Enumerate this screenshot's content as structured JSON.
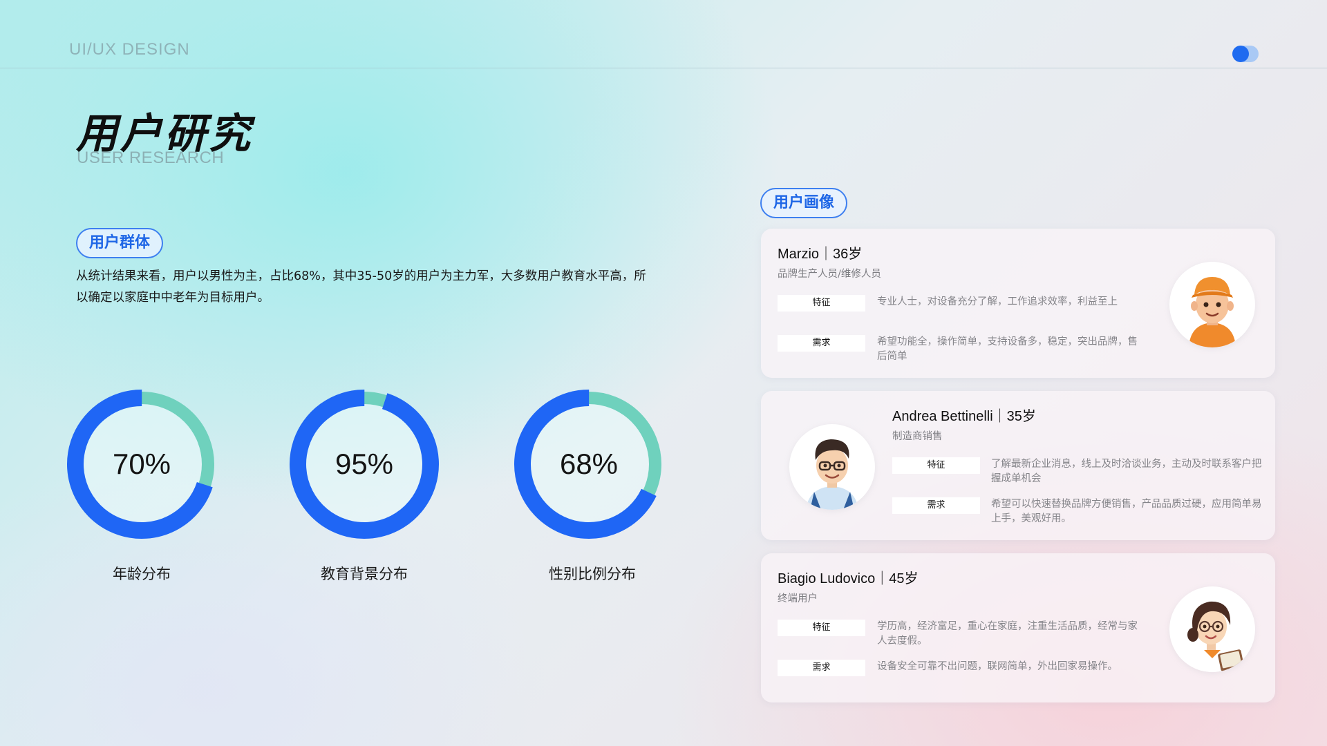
{
  "header": {
    "brand": "UI/UX DESIGN"
  },
  "page": {
    "title": "用户研究",
    "subtitle": "USER RESEARCH"
  },
  "user_group": {
    "label": "用户群体",
    "description": "从统计结果来看，用户以男性为主，占比68%，其中35-50岁的用户为主力军，大多数用户教育水平高，所以确定以家庭中中老年为目标用户。"
  },
  "stats": [
    {
      "value": "70%",
      "fraction": 0.7,
      "caption": "年龄分布"
    },
    {
      "value": "95%",
      "fraction": 0.95,
      "caption": "教育背景分布"
    },
    {
      "value": "68%",
      "fraction": 0.68,
      "caption": "性别比例分布"
    }
  ],
  "colors": {
    "accent": "#1f6bf0",
    "ring_primary": "#1f66f5",
    "ring_secondary": "#6fd1bd",
    "pill_text": "#1e66e6"
  },
  "personas_label": "用户画像",
  "personas": [
    {
      "name": "Marzio｜36岁",
      "role": "品牌生产人员/维修人员",
      "traits_tag": "特征",
      "traits": "专业人士，对设备充分了解，工作追求效率，利益至上",
      "needs_tag": "需求",
      "needs": "希望功能全，操作简单，支持设备多，稳定，突出品牌，售后简单",
      "avatar_icon": "worker-avatar-icon"
    },
    {
      "name": "Andrea  Bettinelli｜35岁",
      "role": "制造商销售",
      "traits_tag": "特征",
      "traits": "了解最新企业消息，线上及时洽谈业务，主动及时联系客户把握成单机会",
      "needs_tag": "需求",
      "needs": "希望可以快速替换品牌方便销售，产品品质过硬，应用简单易上手，美观好用。",
      "avatar_icon": "salesman-avatar-icon"
    },
    {
      "name": "Biagio  Ludovico｜45岁",
      "role": "终端用户",
      "traits_tag": "特征",
      "traits": "学历高，经济富足，重心在家庭，注重生活品质，经常与家人去度假。",
      "needs_tag": "需求",
      "needs": "设备安全可靠不出问题，联网简单，外出回家易操作。",
      "avatar_icon": "reader-avatar-icon"
    }
  ]
}
